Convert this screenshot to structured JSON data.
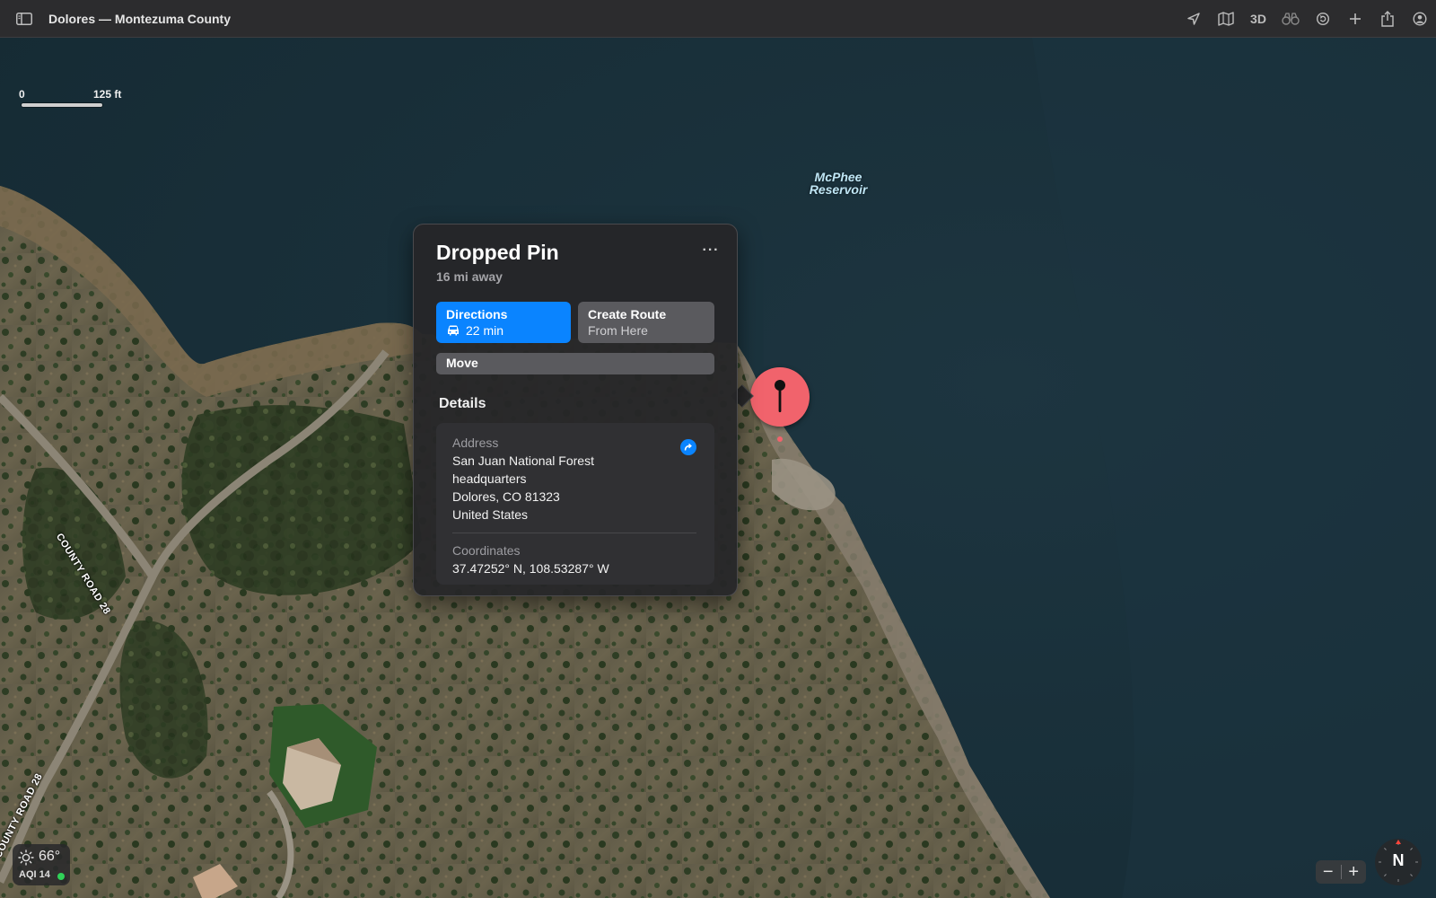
{
  "window": {
    "title": "Dolores — Montezuma County"
  },
  "toolbar": {
    "sidebar_icon": "sidebar-icon",
    "buttons": [
      {
        "name": "current-location-button",
        "icon": "location-arrow-icon"
      },
      {
        "name": "map-mode-button",
        "icon": "map-icon"
      },
      {
        "name": "3d-button",
        "label": "3D"
      },
      {
        "name": "look-around-button",
        "icon": "binoculars-icon"
      },
      {
        "name": "track-button",
        "icon": "refresh-icon"
      },
      {
        "name": "add-button",
        "icon": "plus-icon"
      },
      {
        "name": "share-button",
        "icon": "share-icon"
      },
      {
        "name": "account-button",
        "icon": "person-circle-icon"
      }
    ]
  },
  "map": {
    "scale": {
      "start": "0",
      "end": "125 ft"
    },
    "water_label": "McPhee Reservoir",
    "road_labels": [
      "COUNTY ROAD 28",
      "COUNTY ROAD 28"
    ]
  },
  "popover": {
    "title": "Dropped Pin",
    "subtitle": "16 mi away",
    "more_label": "···",
    "directions": {
      "label": "Directions",
      "eta": "22 min"
    },
    "create_route": {
      "label": "Create Route",
      "sub": "From Here"
    },
    "move_label": "Move",
    "details_heading": "Details",
    "address": {
      "label": "Address",
      "line1": "San Juan National Forest",
      "line2": "headquarters",
      "line3": "Dolores, CO  81323",
      "line4": "United States"
    },
    "coordinates": {
      "label": "Coordinates",
      "value": "37.47252° N, 108.53287° W"
    }
  },
  "weather": {
    "temperature": "66°",
    "aqi": "AQI 14",
    "aqi_color": "#30d158"
  },
  "zoom": {
    "out": "−",
    "in": "+"
  },
  "compass": {
    "label": "N"
  },
  "colors": {
    "accent": "#0a84ff",
    "pin": "#f1636c",
    "water": "#19303a",
    "toolbar": "#2c2c2e"
  }
}
